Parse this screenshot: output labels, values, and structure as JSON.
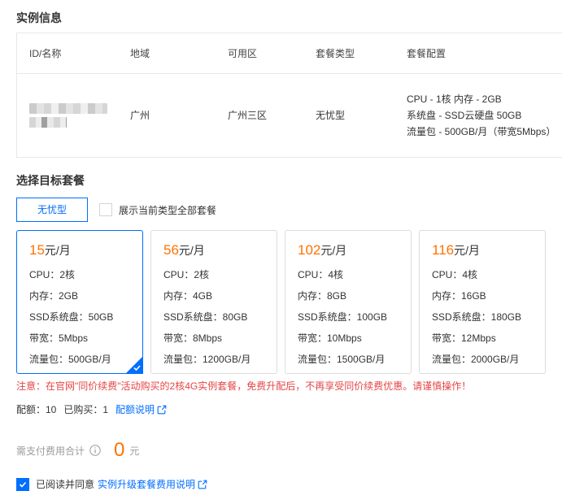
{
  "colors": {
    "accent_blue": "#006eff",
    "price_orange": "#ff7200",
    "warning_red": "#e54545",
    "border_gray": "#e5e8ed",
    "text_dark": "#333333",
    "text_gray": "#9b9b9b"
  },
  "instance_info": {
    "section_title": "实例信息",
    "table": {
      "headers": [
        "ID/名称",
        "地域",
        "可用区",
        "套餐类型",
        "套餐配置"
      ],
      "row": {
        "id_redacted": true,
        "region": "广州",
        "zone": "广州三区",
        "package_type": "无忧型",
        "config_lines": {
          "0": "CPU - 1核 内存 - 2GB",
          "1": "系统盘 - SSD云硬盘 50GB",
          "2": "流量包 - 500GB/月（带宽5Mbps）"
        }
      }
    }
  },
  "target_package": {
    "section_title": "选择目标套餐",
    "type_tab_label": "无忧型",
    "show_all_checkbox": {
      "label": "展示当前类型全部套餐",
      "checked": false
    },
    "plans": [
      {
        "price": "15",
        "unit": "元/月",
        "selected": true,
        "specs": {
          "0": "CPU：2核",
          "1": "内存：2GB",
          "2": "SSD系统盘：50GB",
          "3": "带宽：5Mbps",
          "4": "流量包：500GB/月"
        }
      },
      {
        "price": "56",
        "unit": "元/月",
        "selected": false,
        "specs": {
          "0": "CPU：2核",
          "1": "内存：4GB",
          "2": "SSD系统盘：80GB",
          "3": "带宽：8Mbps",
          "4": "流量包：1200GB/月"
        }
      },
      {
        "price": "102",
        "unit": "元/月",
        "selected": false,
        "specs": {
          "0": "CPU：4核",
          "1": "内存：8GB",
          "2": "SSD系统盘：100GB",
          "3": "带宽：10Mbps",
          "4": "流量包：1500GB/月"
        }
      },
      {
        "price": "116",
        "unit": "元/月",
        "selected": false,
        "specs": {
          "0": "CPU：4核",
          "1": "内存：16GB",
          "2": "SSD系统盘：180GB",
          "3": "带宽：12Mbps",
          "4": "流量包：2000GB/月"
        }
      }
    ],
    "warning": "注意：在官网\"同价续费\"活动购买的2核4G实例套餐，免费升配后，不再享受同价续费优惠。请谨慎操作！",
    "quota": {
      "quota_text": "配额：10",
      "purchased_text": "已购买：1",
      "link_label": "配额说明"
    }
  },
  "payment": {
    "total_label": "需支付费用合计",
    "amount": "0",
    "currency": "元"
  },
  "agreement": {
    "checked": true,
    "text": "已阅读并同意",
    "link_label": "实例升级套餐费用说明"
  }
}
